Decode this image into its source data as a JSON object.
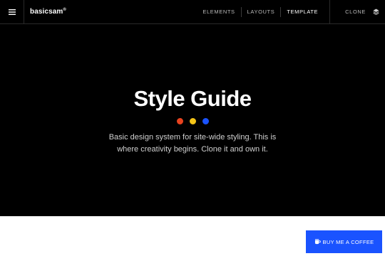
{
  "header": {
    "brand": "basicsam",
    "brand_mark": "®",
    "menu_icon": "hamburger-menu-icon",
    "nav": [
      {
        "label": "ELEMENTS",
        "active": false
      },
      {
        "label": "LAYOUTS",
        "active": false
      },
      {
        "label": "TEMPLATE",
        "active": true
      }
    ],
    "clone_label": "CLONE",
    "clone_icon": "layers-icon"
  },
  "hero": {
    "title": "Style Guide",
    "subtitle_line1": "Basic design system for site-wide styling. This is",
    "subtitle_line2": "where creativity begins. Clone it and own it.",
    "dots": [
      "#e8431f",
      "#f5c518",
      "#1a53ff"
    ]
  },
  "cta": {
    "label": "BUY ME A COFFEE",
    "icon": "coffee-cup-icon",
    "color": "#1a53ff"
  },
  "colors": {
    "background": "#000000",
    "accent": "#1a53ff"
  }
}
